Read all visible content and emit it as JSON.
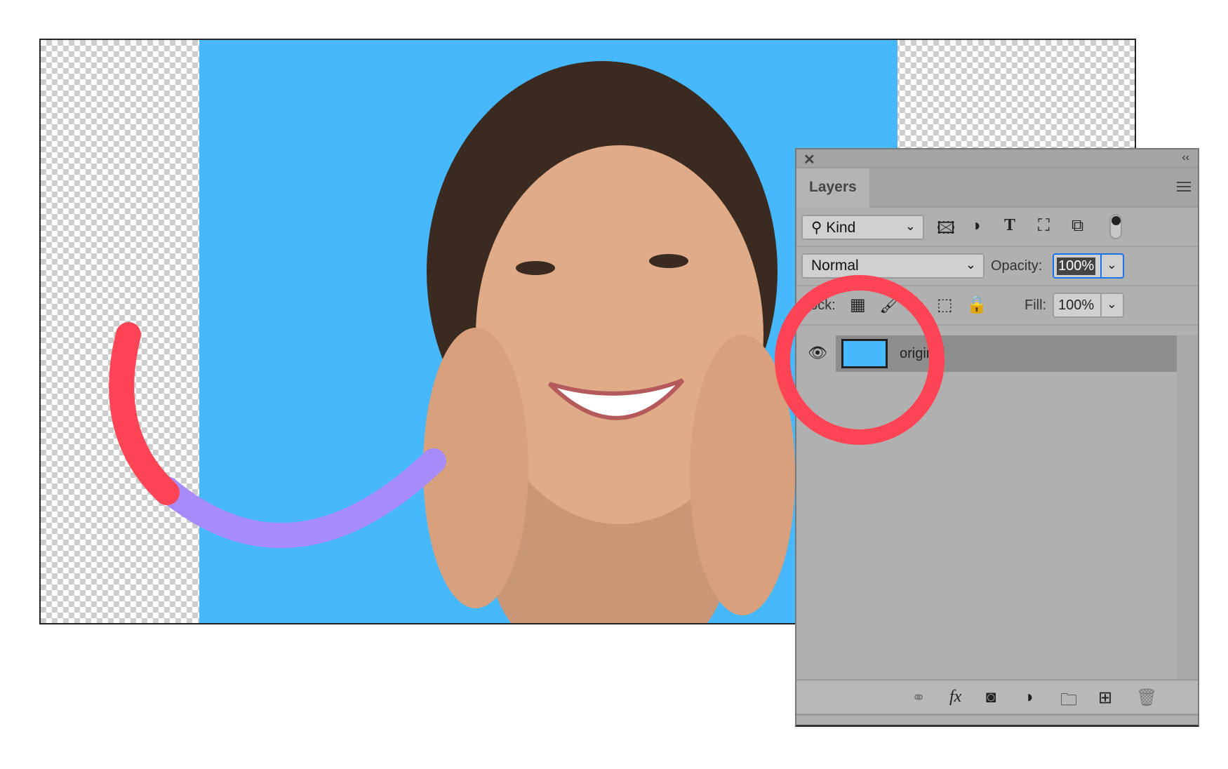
{
  "panel": {
    "title": "Layers",
    "filter": {
      "kind_label": "Kind",
      "icons": [
        "image-filter-icon",
        "adjustment-filter-icon",
        "type-filter-icon",
        "shape-filter-icon",
        "smart-object-filter-icon",
        "filter-toggle"
      ]
    },
    "blend_mode": "Normal",
    "opacity_label": "Opacity:",
    "opacity_value": "100%",
    "lock_label": "Lock:",
    "fill_label": "Fill:",
    "fill_value": "100%",
    "layers": [
      {
        "name": "original",
        "visible": true
      }
    ],
    "bottom_icons": [
      "link-icon",
      "fx-icon",
      "mask-icon",
      "adjustment-icon",
      "folder-icon",
      "new-layer-icon",
      "trash-icon"
    ]
  },
  "colors": {
    "canvas_bg": "#47b8fb",
    "highlight_circle": "#ff4455",
    "arc_red": "#ff4455",
    "arc_purple": "#a78bfa",
    "accent": "#1a73e8"
  }
}
